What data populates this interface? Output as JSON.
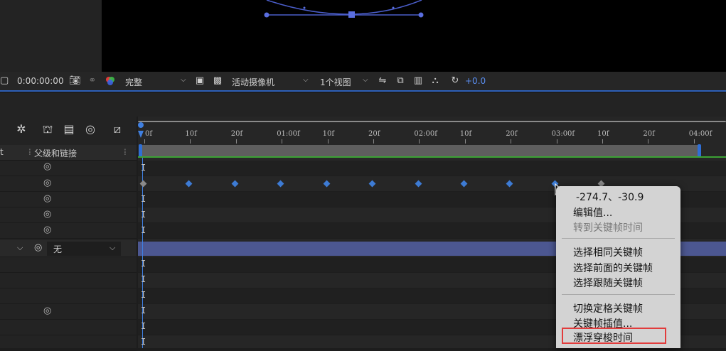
{
  "toolbar": {
    "timecode": "0:00:00:00",
    "resolution": "完整",
    "camera": "活动摄像机",
    "views": "1个视图",
    "exposure": "+0.0"
  },
  "columns": {
    "t_header": "t",
    "parent_link": "父级和链接",
    "parent_value": "无"
  },
  "ruler": {
    "labels": [
      "0f",
      "10f",
      "20f",
      "01:00f",
      "10f",
      "20f",
      "02:00f",
      "10f",
      "20f",
      "03:00f",
      "10f",
      "20f",
      "04:00f"
    ]
  },
  "context_menu": {
    "value": "-274.7、-30.9",
    "edit_value": "编辑值...",
    "goto_time": "转到关键帧时间",
    "select_same": "选择相同关键帧",
    "select_previous": "选择前面的关键帧",
    "select_following": "选择跟随关键帧",
    "toggle_hold": "切换定格关键帧",
    "interpolation": "关键帧插值...",
    "rove_across_time": "漂浮穿梭时间"
  },
  "colors": {
    "accent": "#2d5fb8",
    "keyframe": "#3d7bd4",
    "layer_bar": "#4c5791",
    "highlight": "#e23c3c"
  }
}
